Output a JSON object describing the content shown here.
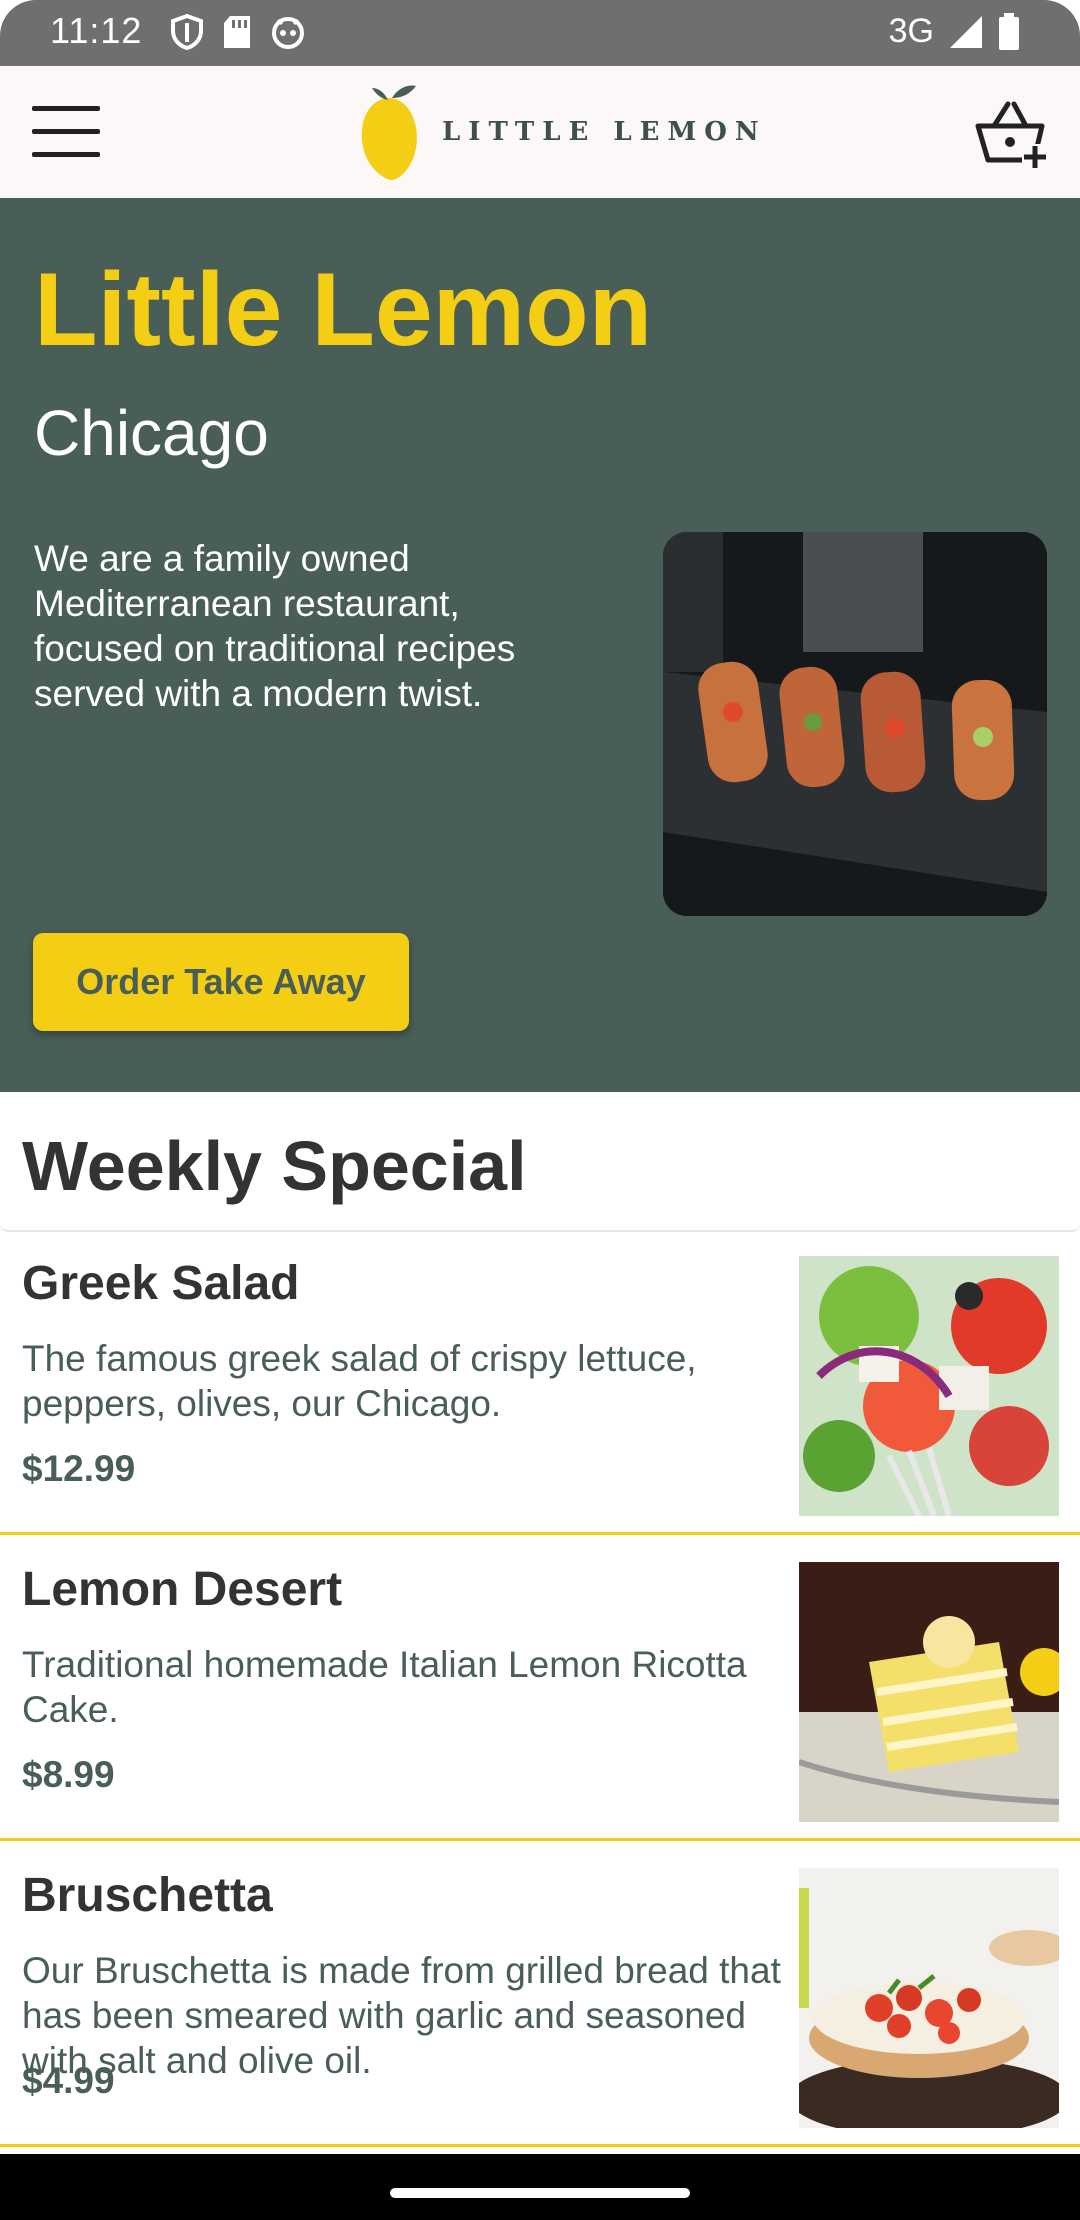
{
  "status_bar": {
    "time": "11:12",
    "network": "3G",
    "icons": [
      "shield-icon",
      "sd-card-icon",
      "robot-icon",
      "signal-icon",
      "battery-icon"
    ]
  },
  "app_bar": {
    "logo_text": "LITTLE LEMON",
    "menu_icon": "hamburger-menu-icon",
    "cart_icon": "basket-add-icon"
  },
  "hero": {
    "title": "Little Lemon",
    "city": "Chicago",
    "description": "We are a family owned Mediterranean restaurant, focused on traditional recipes served with a modern twist.",
    "button_label": "Order Take Away"
  },
  "weekly_special": {
    "heading": "Weekly Special"
  },
  "menu_items": [
    {
      "name": "Greek Salad",
      "description": "The famous greek salad of crispy lettuce, peppers, olives, our Chicago.",
      "price": "$12.99"
    },
    {
      "name": "Lemon Desert",
      "description": "Traditional homemade Italian Lemon Ricotta Cake.",
      "price": "$8.99"
    },
    {
      "name": "Bruschetta",
      "description": "Our Bruschetta is made from grilled bread that has been smeared with garlic and seasoned with salt and olive oil.",
      "price": "$4.99"
    }
  ],
  "colors": {
    "primary_green": "#495e57",
    "primary_yellow": "#f4ce14",
    "appbar_bg": "#fbf8f7"
  }
}
